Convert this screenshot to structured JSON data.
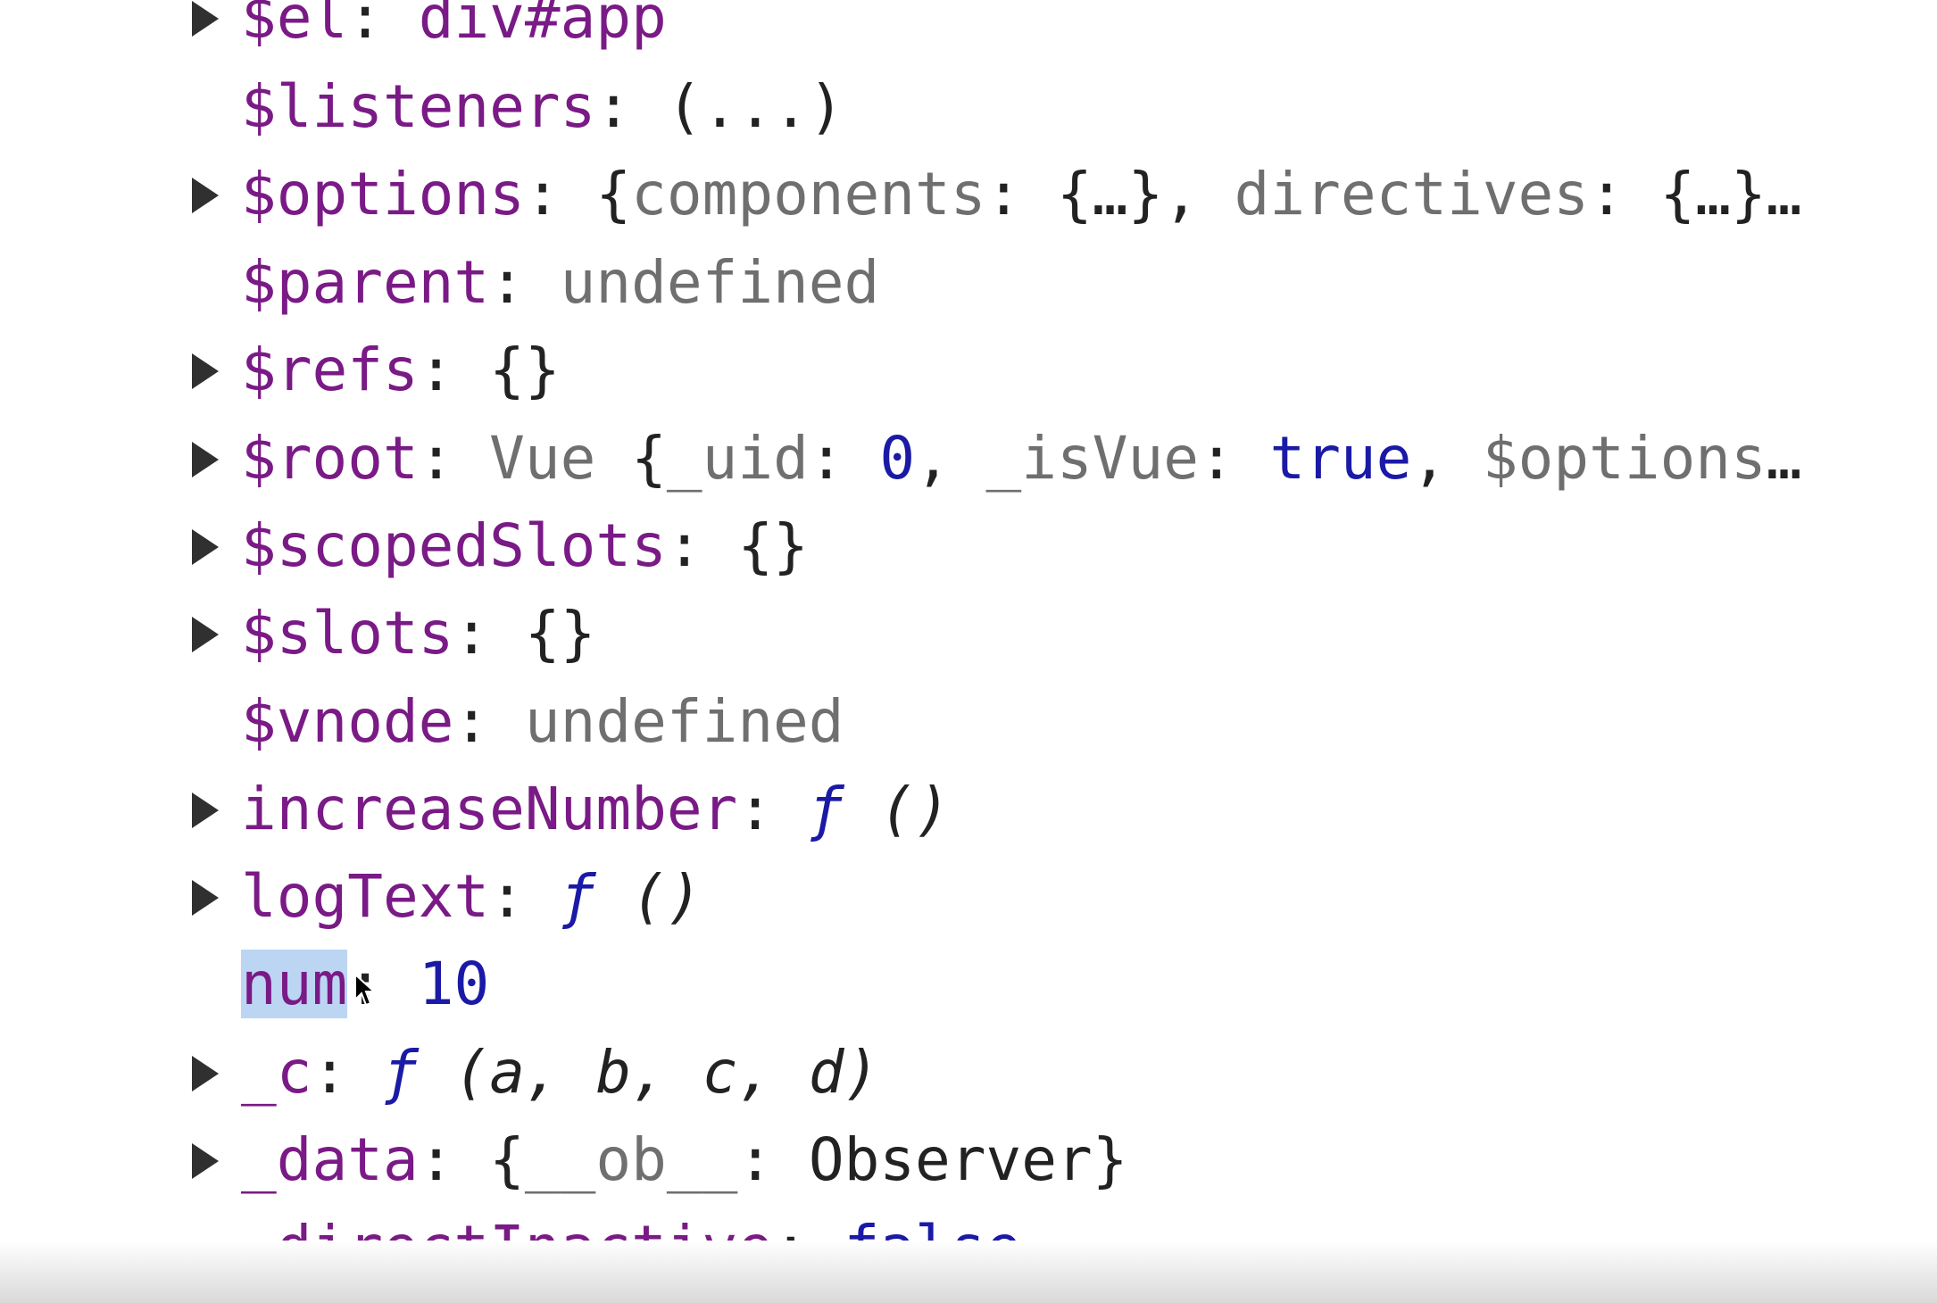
{
  "rows": [
    {
      "expandable": true,
      "key": "$el",
      "sep": ": ",
      "value": "div#app"
    },
    {
      "expandable": false,
      "key": "$listeners",
      "sep": ": ",
      "value": "(...)"
    },
    {
      "expandable": true,
      "key": "$options",
      "sep": ": ",
      "parts": [
        "{",
        "components",
        ": ",
        "{…}",
        ", ",
        "directives",
        ": ",
        "{…}",
        "…"
      ]
    },
    {
      "expandable": false,
      "key": "$parent",
      "sep": ": ",
      "value": "undefined"
    },
    {
      "expandable": true,
      "key": "$refs",
      "sep": ": ",
      "value": "{}"
    },
    {
      "expandable": true,
      "key": "$root",
      "sep": ": ",
      "parts": [
        "Vue ",
        "{",
        "_uid",
        ": ",
        "0",
        ", ",
        "_isVue",
        ": ",
        "true",
        ", ",
        "$options",
        "…"
      ]
    },
    {
      "expandable": true,
      "key": "$scopedSlots",
      "sep": ": ",
      "value": "{}"
    },
    {
      "expandable": true,
      "key": "$slots",
      "sep": ": ",
      "value": "{}"
    },
    {
      "expandable": false,
      "key": "$vnode",
      "sep": ": ",
      "value": "undefined"
    },
    {
      "expandable": true,
      "key": "increaseNumber",
      "sep": ": ",
      "fn": "ƒ",
      "args": " ()"
    },
    {
      "expandable": true,
      "key": "logText",
      "sep": ": ",
      "fn": "ƒ",
      "args": " ()"
    },
    {
      "expandable": false,
      "key": "num",
      "sep": ": ",
      "value": "10",
      "selected": true
    },
    {
      "expandable": true,
      "key": "_c",
      "sep": ": ",
      "fn": "ƒ",
      "args": " (a, b, c, d)"
    },
    {
      "expandable": true,
      "key": "_data",
      "sep": ": ",
      "parts": [
        "{",
        "__ob__",
        ": ",
        "Observer",
        "}"
      ]
    },
    {
      "expandable": false,
      "key": "_directInactive",
      "sep": ": ",
      "value": "false"
    }
  ]
}
